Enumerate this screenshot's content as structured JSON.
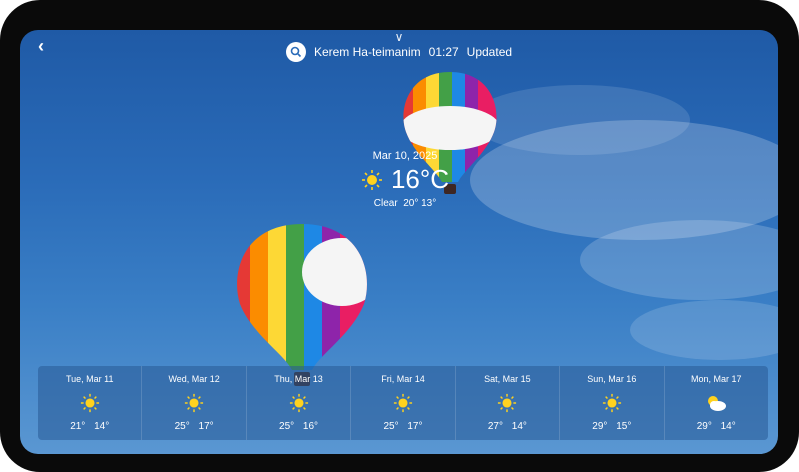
{
  "header": {
    "location": "Kerem Ha-teimanim",
    "time": "01:27",
    "status": "Updated"
  },
  "current": {
    "date": "Mar 10, 2025",
    "temperature": "16°C",
    "condition": "Clear",
    "high_low": "20°  13°",
    "icon": "sun-icon"
  },
  "forecast": [
    {
      "day": "Tue, Mar 11",
      "icon": "sun-icon",
      "temps": "21°  14°"
    },
    {
      "day": "Wed, Mar 12",
      "icon": "sun-icon",
      "temps": "25°  17°"
    },
    {
      "day": "Thu, Mar 13",
      "icon": "sun-icon",
      "temps": "25°  16°"
    },
    {
      "day": "Fri, Mar 14",
      "icon": "sun-icon",
      "temps": "25°  17°"
    },
    {
      "day": "Sat, Mar 15",
      "icon": "sun-icon",
      "temps": "27°  14°"
    },
    {
      "day": "Sun, Mar 16",
      "icon": "sun-icon",
      "temps": "29°  15°"
    },
    {
      "day": "Mon, Mar 17",
      "icon": "partly-cloudy-icon",
      "temps": "29°  14°"
    }
  ],
  "colors": {
    "sun": "#ffd21e",
    "sky_top": "#1f5aa6",
    "sky_bottom": "#5a97d2"
  }
}
